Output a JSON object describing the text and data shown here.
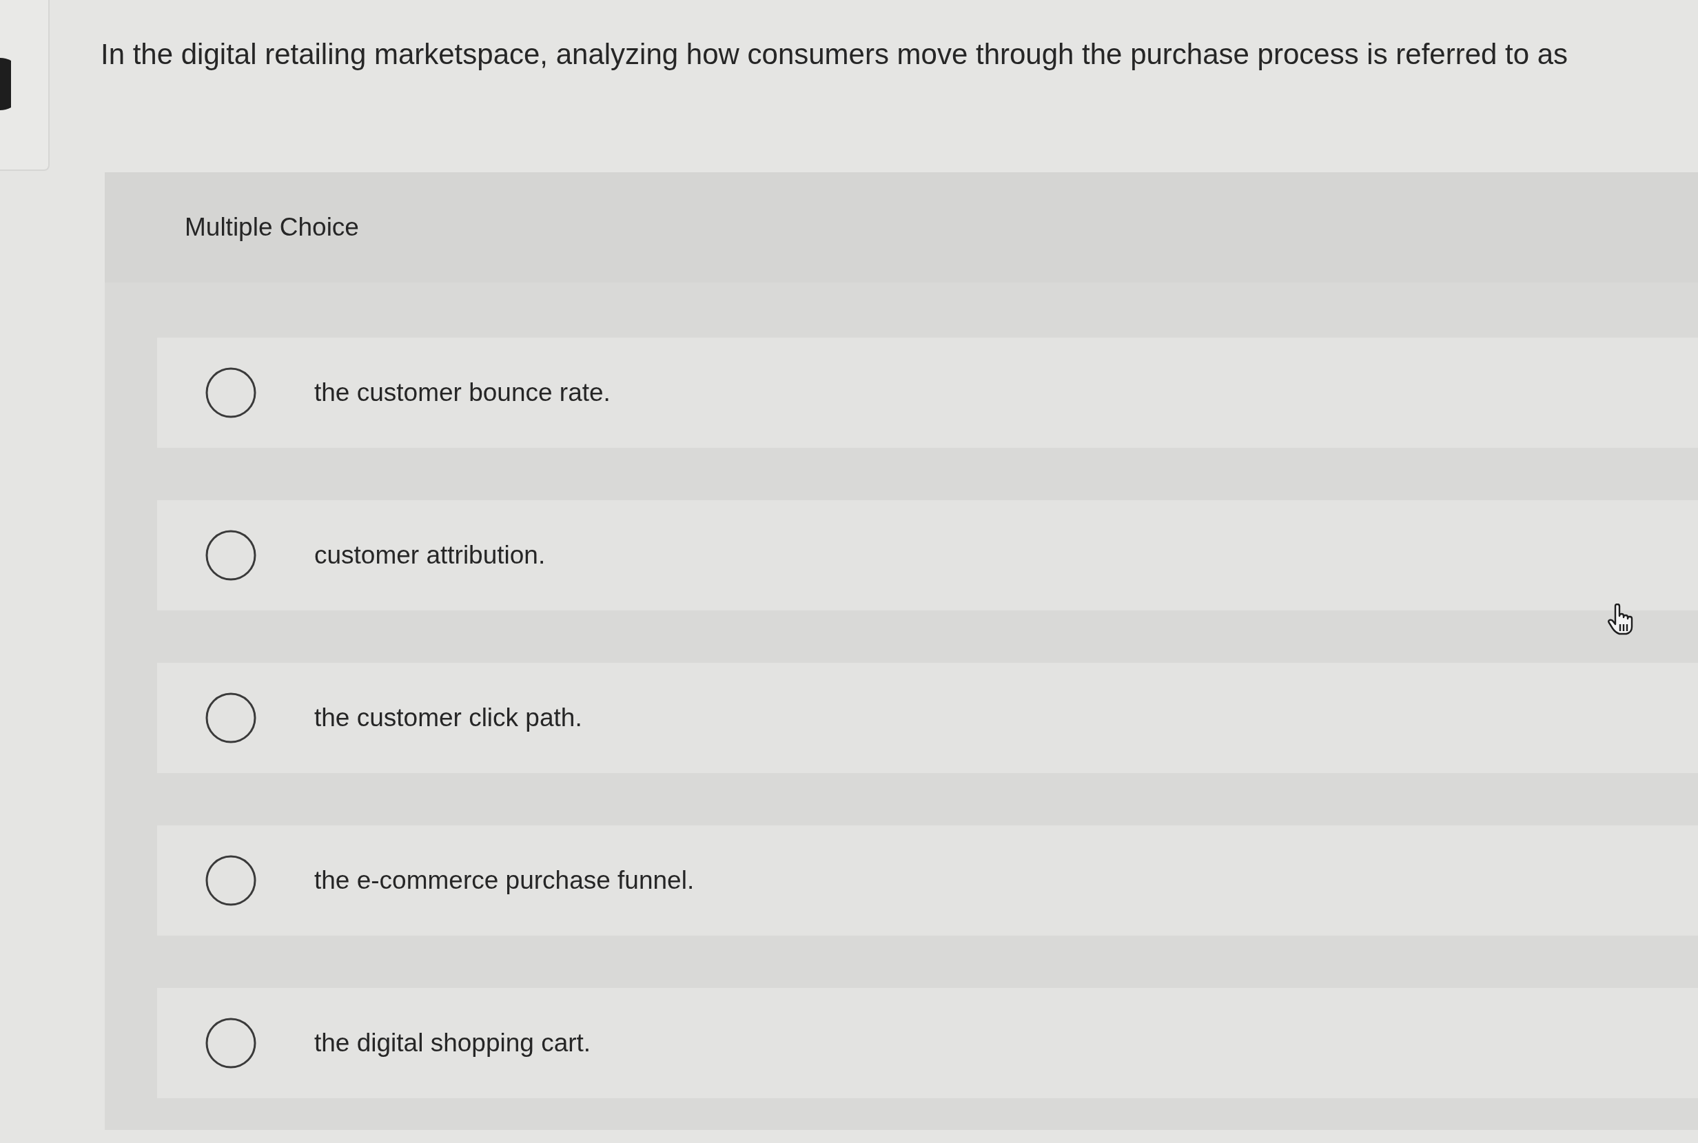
{
  "question": {
    "text": "In the digital retailing marketspace, analyzing how consumers move through the purchase process is referred to as"
  },
  "answer_panel": {
    "label": "Multiple Choice",
    "options": [
      {
        "text": "the customer bounce rate.",
        "selected": false
      },
      {
        "text": "customer attribution.",
        "selected": false
      },
      {
        "text": "the customer click path.",
        "selected": false
      },
      {
        "text": "the e-commerce purchase funnel.",
        "selected": false
      },
      {
        "text": "the digital shopping cart.",
        "selected": false
      }
    ]
  }
}
